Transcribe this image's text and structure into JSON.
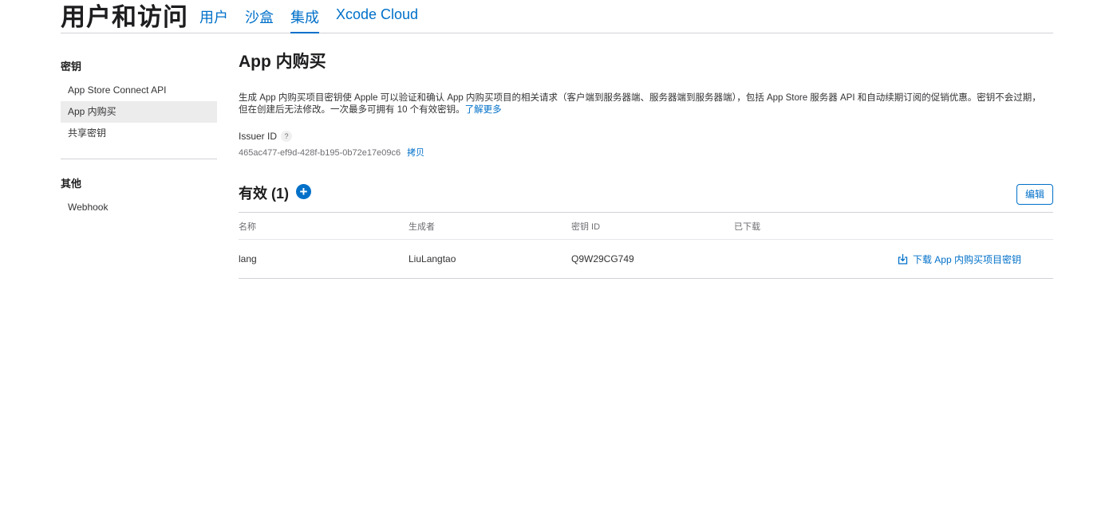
{
  "header": {
    "title": "用户和访问",
    "tabs": [
      {
        "label": "用户"
      },
      {
        "label": "沙盒"
      },
      {
        "label": "集成"
      },
      {
        "label": "Xcode Cloud"
      }
    ]
  },
  "sidebar": {
    "groups": [
      {
        "title": "密钥",
        "items": [
          {
            "label": "App Store Connect API"
          },
          {
            "label": "App 内购买"
          },
          {
            "label": "共享密钥"
          }
        ]
      },
      {
        "title": "其他",
        "items": [
          {
            "label": "Webhook"
          }
        ]
      }
    ]
  },
  "main": {
    "title": "App 内购买",
    "description": "生成 App 内购买项目密钥使 Apple 可以验证和确认 App 内购买项目的相关请求（客户端到服务器端、服务器端到服务器端），包括 App Store 服务器 API 和自动续期订阅的促销优惠。密钥不会过期，但在创建后无法修改。一次最多可拥有 10 个有效密钥。",
    "learn_more": "了解更多",
    "issuer_label": "Issuer ID",
    "help_glyph": "?",
    "issuer_id": "465ac477-ef9d-428f-b195-0b72e17e09c6",
    "copy_label": "拷贝",
    "active_title": "有效 (1)",
    "add_glyph": "+",
    "edit_label": "编辑",
    "table": {
      "columns": [
        "名称",
        "生成者",
        "密钥 ID",
        "已下载"
      ],
      "rows": [
        {
          "name": "lang",
          "creator": "LiuLangtao",
          "key_id": "Q9W29CG749",
          "downloaded": "",
          "action": "下载 App 内购买项目密钥"
        }
      ]
    }
  },
  "colors": {
    "accent": "#0070c9",
    "text": "#1d1d1f",
    "border": "#d2d2d7",
    "sidebar_active": "#ececec"
  }
}
